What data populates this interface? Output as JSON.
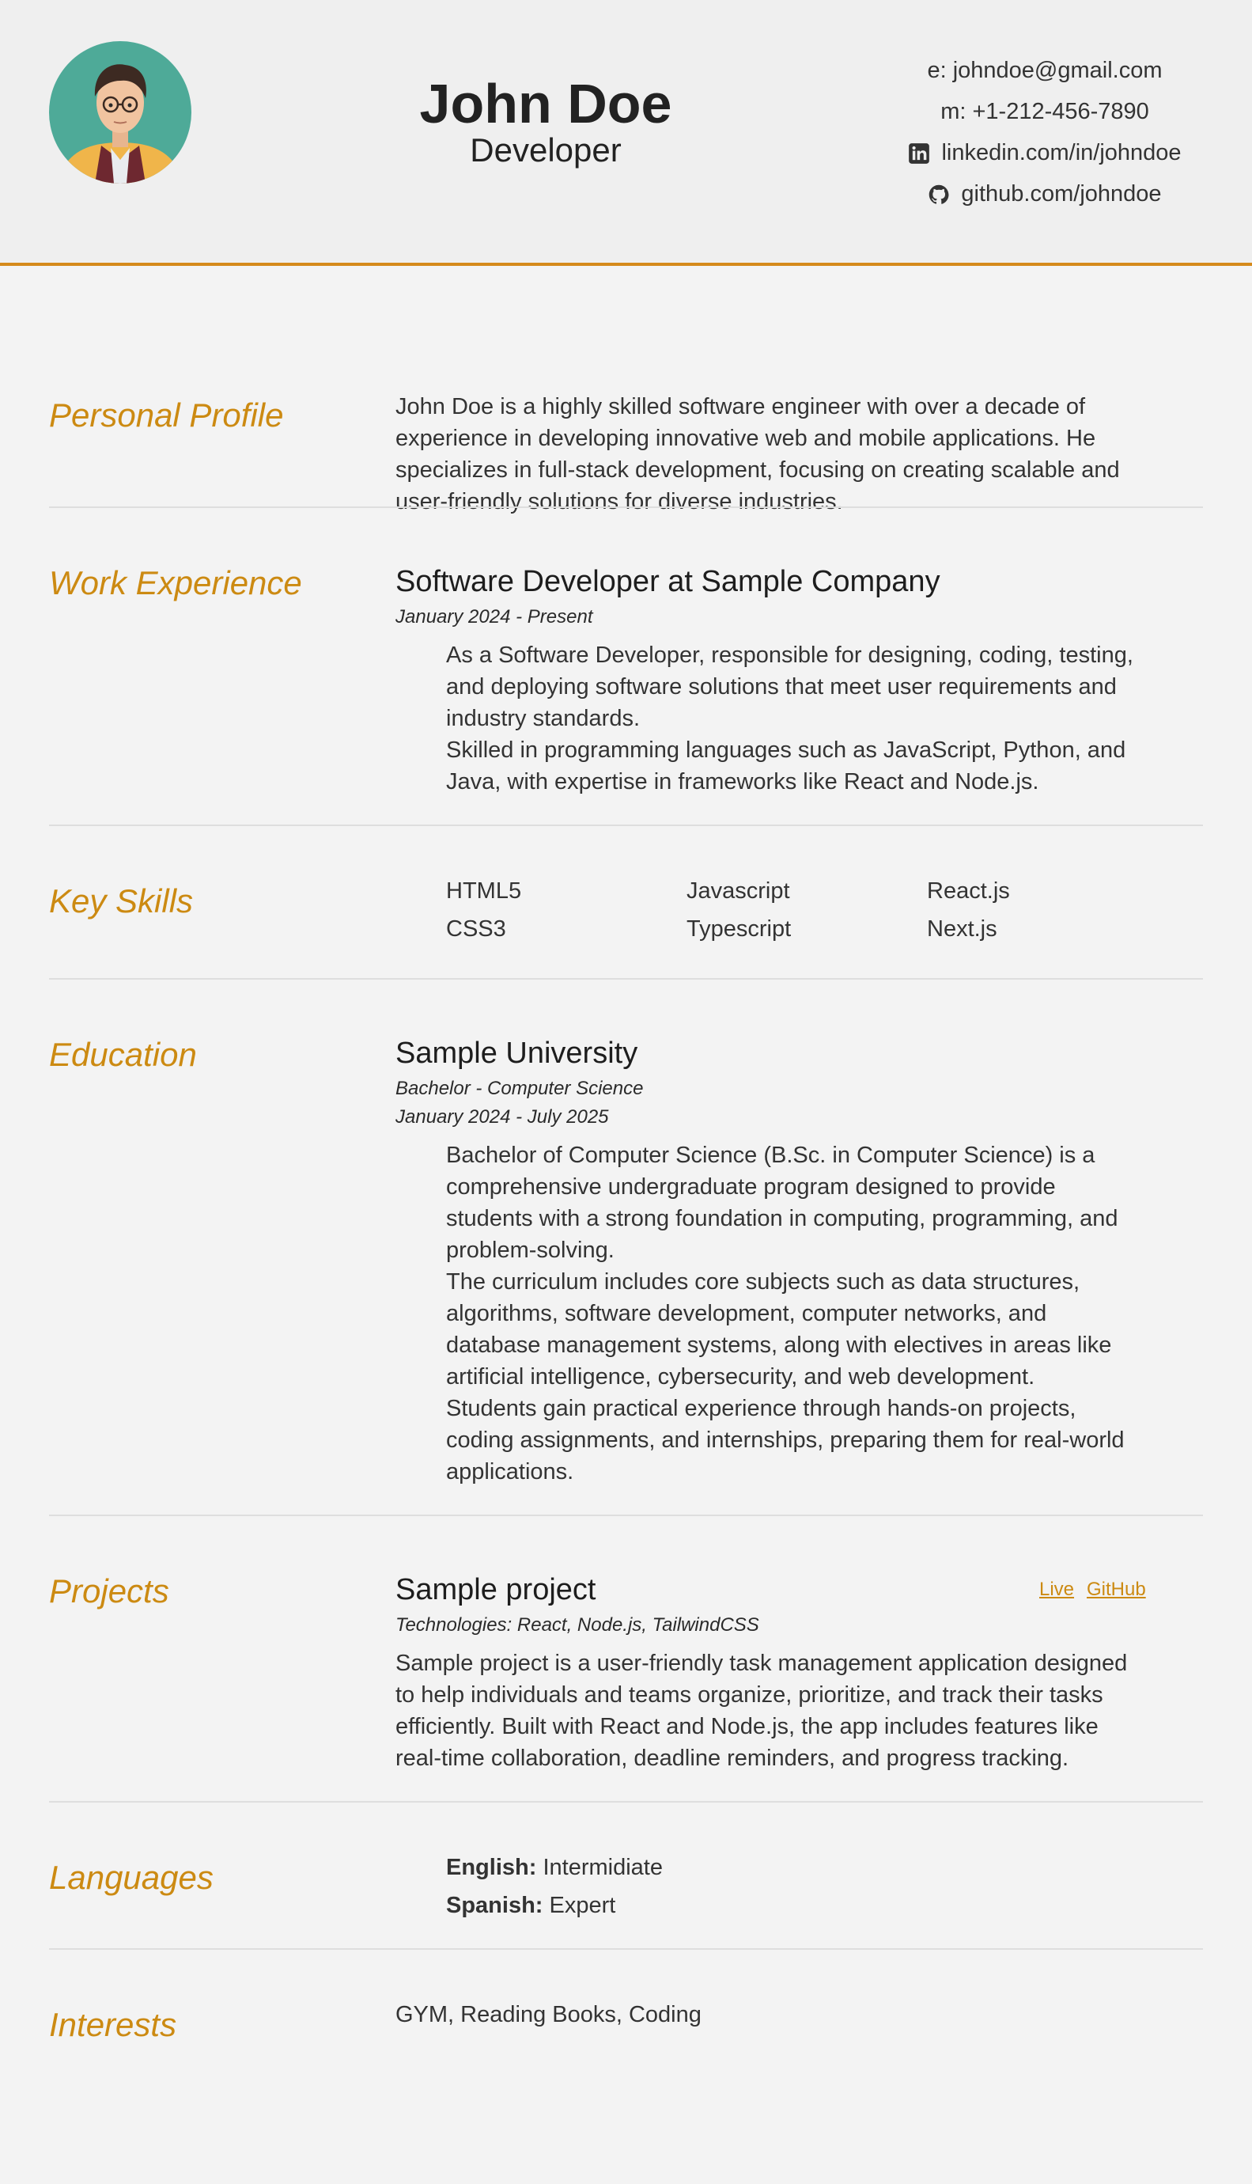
{
  "header": {
    "name": "John Doe",
    "role": "Developer",
    "email": "e: johndoe@gmail.com",
    "phone": "m: +1-212-456-7890",
    "linkedin": "linkedin.com/in/johndoe",
    "github": "github.com/johndoe",
    "linkedin_icon": "linkedin-icon",
    "github_icon": "github-icon"
  },
  "colors": {
    "accent": "#d58a1b",
    "section_title": "#cc8a12",
    "background": "#f3f3f3"
  },
  "profile": {
    "title": "Personal Profile",
    "text": "John Doe is a highly skilled software engineer with over a decade of experience in developing innovative web and mobile applications. He specializes in full-stack development, focusing on creating scalable and user-friendly solutions for diverse industries."
  },
  "work": {
    "title": "Work Experience",
    "job_title": "Software Developer at Sample Company",
    "dates": "January 2024 - Present",
    "bullets": [
      "As a Software Developer, responsible for designing, coding, testing, and deploying software solutions that meet user requirements and industry standards.",
      "Skilled in programming languages such as JavaScript, Python, and Java, with expertise in frameworks like React and Node.js."
    ]
  },
  "skills": {
    "title": "Key Skills",
    "items": [
      "HTML5",
      "Javascript",
      "React.js",
      "CSS3",
      "Typescript",
      "Next.js"
    ]
  },
  "education": {
    "title": "Education",
    "school": "Sample University",
    "degree": "Bachelor - Computer Science",
    "dates": "January 2024 - July 2025",
    "paragraphs": [
      "Bachelor of Computer Science (B.Sc. in Computer Science) is a comprehensive undergraduate program designed to provide students with a strong foundation in computing, programming, and problem-solving.",
      "The curriculum includes core subjects such as data structures, algorithms, software development, computer networks, and database management systems, along with electives in areas like artificial intelligence, cybersecurity, and web development.",
      "Students gain practical experience through hands-on projects, coding assignments, and internships, preparing them for real-world applications."
    ]
  },
  "projects": {
    "title": "Projects",
    "name": "Sample project",
    "tech": "Technologies: React, Node.js, TailwindCSS",
    "live_label": "Live",
    "github_label": "GitHub",
    "description": "Sample project is a user-friendly task management application designed to help individuals and teams organize, prioritize, and track their tasks efficiently. Built with React and Node.js, the app includes features like real-time collaboration, deadline reminders, and progress tracking."
  },
  "languages": {
    "title": "Languages",
    "items": [
      {
        "name": "English:",
        "level": "Intermidiate"
      },
      {
        "name": "Spanish:",
        "level": "Expert"
      }
    ]
  },
  "interests": {
    "title": "Interests",
    "text": "GYM, Reading Books, Coding"
  }
}
